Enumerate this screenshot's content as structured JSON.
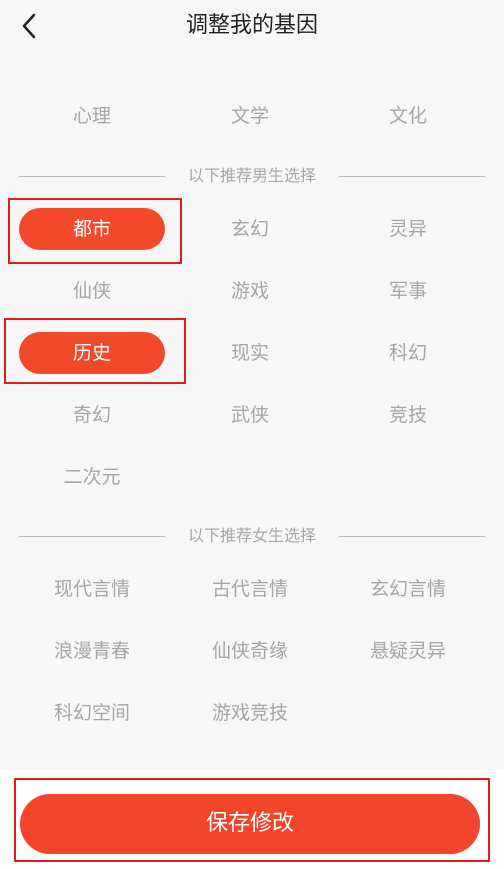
{
  "header": {
    "title": "调整我的基因",
    "back_icon": "chevron-left-icon"
  },
  "top_cut": [
    "",
    "",
    ""
  ],
  "row_general": [
    "心理",
    "文学",
    "文化"
  ],
  "male_section": {
    "label": "以下推荐男生选择",
    "rows": [
      [
        "都市",
        "玄幻",
        "灵异"
      ],
      [
        "仙侠",
        "游戏",
        "军事"
      ],
      [
        "历史",
        "现实",
        "科幻"
      ],
      [
        "奇幻",
        "武侠",
        "竞技"
      ],
      [
        "二次元"
      ]
    ],
    "selected": [
      "都市",
      "历史"
    ]
  },
  "female_section": {
    "label": "以下推荐女生选择",
    "rows": [
      [
        "现代言情",
        "古代言情",
        "玄幻言情"
      ],
      [
        "浪漫青春",
        "仙侠奇缘",
        "悬疑灵异"
      ],
      [
        "科幻空间",
        "游戏竞技"
      ]
    ]
  },
  "footer": {
    "save_label": "保存修改"
  },
  "colors": {
    "accent": "#f2492b",
    "highlight_box": "#e31d1d"
  }
}
